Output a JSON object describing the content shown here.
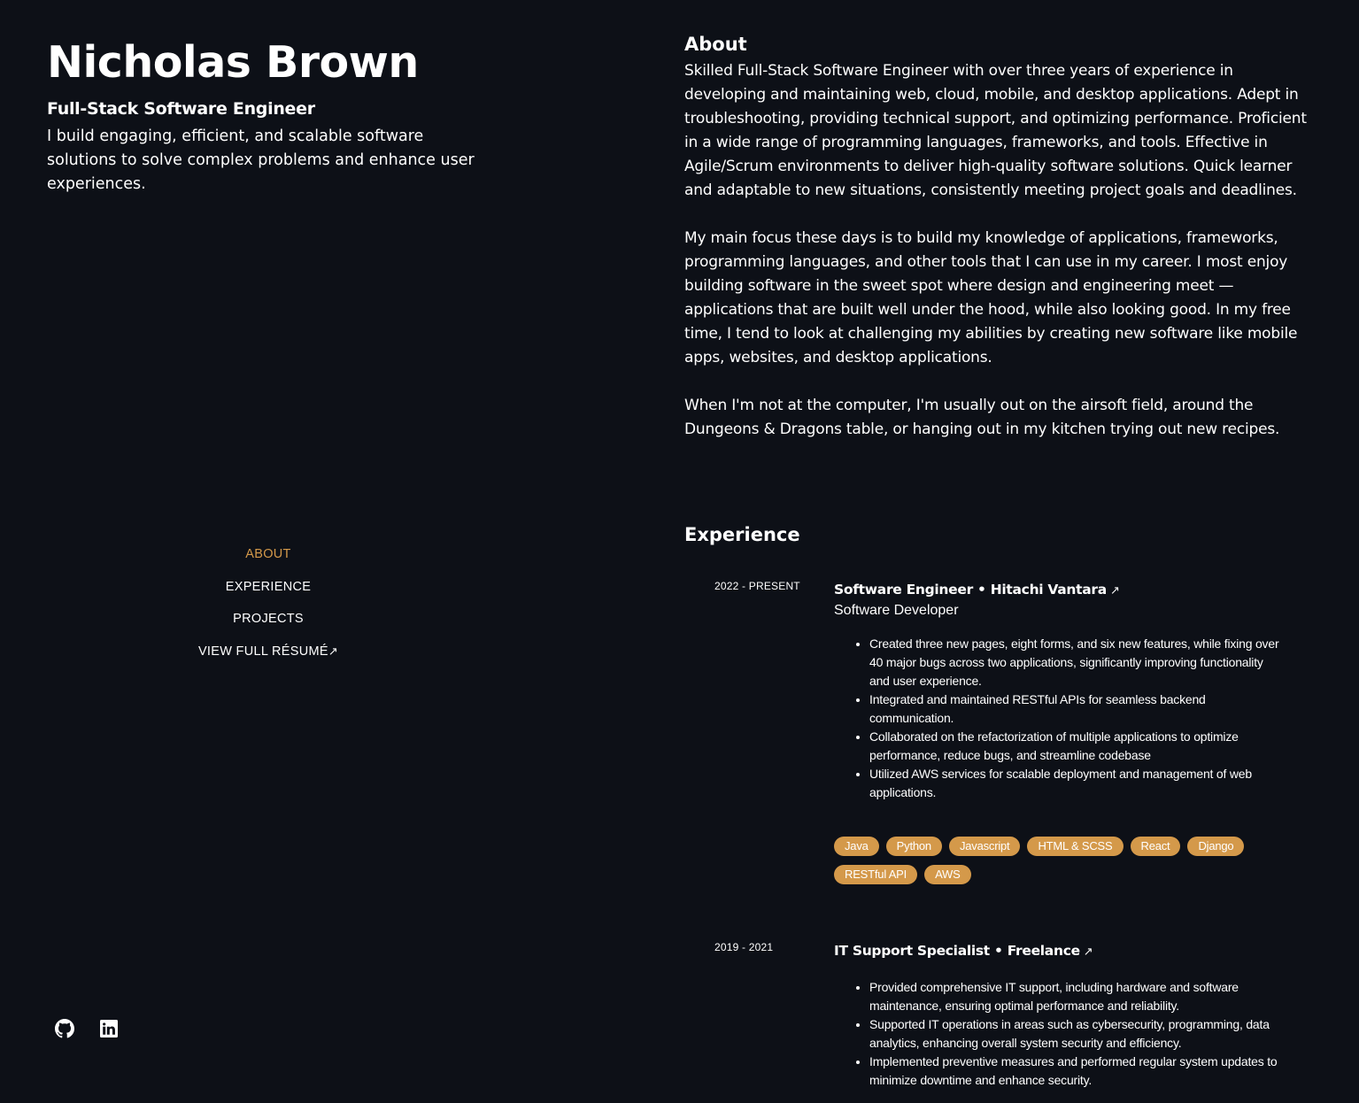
{
  "profile": {
    "name": "Nicholas Brown",
    "role": "Full-Stack Software Engineer",
    "tagline": "I build engaging, efficient, and scalable software solutions to solve complex problems and enhance user experiences."
  },
  "nav": {
    "items": [
      {
        "label": "ABOUT",
        "active": true
      },
      {
        "label": "EXPERIENCE",
        "active": false
      },
      {
        "label": "PROJECTS",
        "active": false
      },
      {
        "label": "VIEW FULL RÉSUMÉ",
        "active": false,
        "external": true
      }
    ]
  },
  "socials": {
    "github_icon": "github-icon",
    "linkedin_icon": "linkedin-icon"
  },
  "about": {
    "title": "About",
    "paragraphs": [
      "Skilled Full-Stack Software Engineer with over three years of experience in developing and maintaining web, cloud, mobile, and desktop applications. Adept in troubleshooting, providing technical support, and optimizing performance. Proficient in a wide range of programming languages, frameworks, and tools. Effective in Agile/Scrum environments to deliver high-quality software solutions. Quick learner and adaptable to new situations, consistently meeting project goals and deadlines.",
      "My main focus these days is to build my knowledge of applications, frameworks, programming languages, and other tools that I can use in my career. I most enjoy building software in the sweet spot where design and engineering meet — applications that are built well under the hood, while also looking good. In my free time, I tend to look at challenging my abilities by creating new software like mobile apps, websites, and desktop applications.",
      "When I'm not at the computer, I'm usually out on the airsoft field, around the Dungeons & Dragons table, or hanging out in my kitchen trying out new recipes."
    ]
  },
  "experience": {
    "title": "Experience",
    "jobs": [
      {
        "dates": "2022 - PRESENT",
        "title": "Software Engineer • Hitachi Vantara",
        "subtitle": "Software Developer",
        "bullets": [
          "Created three new pages, eight forms, and six new features, while fixing over 40 major bugs across two applications, significantly improving functionality and user experience.",
          "Integrated and maintained RESTful APIs for seamless backend communication.",
          "Collaborated on the refactorization of multiple applications to optimize performance, reduce bugs, and streamline codebase",
          "Utilized AWS services for scalable deployment and management of web applications."
        ],
        "tags": [
          "Java",
          "Python",
          "Javascript",
          "HTML & SCSS",
          "React",
          "Django",
          "RESTful API",
          "AWS"
        ]
      },
      {
        "dates": "2019 - 2021",
        "title": "IT Support Specialist • Freelance",
        "subtitle": "",
        "bullets": [
          "Provided comprehensive IT support, including hardware and software maintenance, ensuring optimal performance and reliability.",
          "Supported IT operations in areas such as cybersecurity, programming, data analytics, enhancing overall system security and efficiency.",
          "Implemented preventive measures and performed regular system updates to minimize downtime and enhance security."
        ],
        "tags": []
      }
    ]
  },
  "colors": {
    "background": "#0d1017",
    "accent": "#d4994a",
    "text": "#ffffff"
  }
}
